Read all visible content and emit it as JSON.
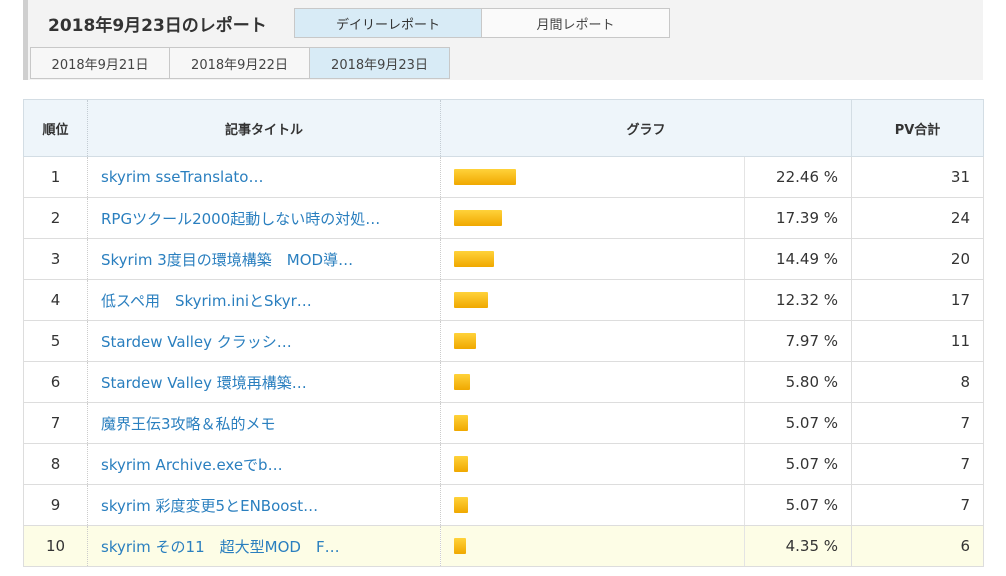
{
  "report": {
    "title": "2018年9月23日のレポート",
    "mode_tabs": [
      {
        "label": "デイリーレポート",
        "active": true
      },
      {
        "label": "月間レポート",
        "active": false
      }
    ],
    "date_tabs": [
      {
        "label": "2018年9月21日",
        "active": false
      },
      {
        "label": "2018年9月22日",
        "active": false
      },
      {
        "label": "2018年9月23日",
        "active": true
      }
    ]
  },
  "table": {
    "headers": {
      "rank": "順位",
      "title": "記事タイトル",
      "graph": "グラフ",
      "pv": "PV合計"
    },
    "rows": [
      {
        "rank": "1",
        "title": "skyrim sseTranslato…",
        "percent": 22.46,
        "percent_text": "22.46 %",
        "pv": "31"
      },
      {
        "rank": "2",
        "title": "RPGツクール2000起動しない時の対処…",
        "percent": 17.39,
        "percent_text": "17.39 %",
        "pv": "24"
      },
      {
        "rank": "3",
        "title": "Skyrim 3度目の環境構築　MOD導…",
        "percent": 14.49,
        "percent_text": "14.49 %",
        "pv": "20"
      },
      {
        "rank": "4",
        "title": "低スペ用　Skyrim.iniとSkyr…",
        "percent": 12.32,
        "percent_text": "12.32 %",
        "pv": "17"
      },
      {
        "rank": "5",
        "title": "Stardew Valley クラッシ…",
        "percent": 7.97,
        "percent_text": "7.97 %",
        "pv": "11"
      },
      {
        "rank": "6",
        "title": "Stardew Valley 環境再構築…",
        "percent": 5.8,
        "percent_text": "5.80 %",
        "pv": "8"
      },
      {
        "rank": "7",
        "title": "魔界王伝3攻略＆私的メモ",
        "percent": 5.07,
        "percent_text": "5.07 %",
        "pv": "7"
      },
      {
        "rank": "8",
        "title": "skyrim Archive.exeでb…",
        "percent": 5.07,
        "percent_text": "5.07 %",
        "pv": "7"
      },
      {
        "rank": "9",
        "title": "skyrim 彩度変更5とENBoost…",
        "percent": 5.07,
        "percent_text": "5.07 %",
        "pv": "7"
      },
      {
        "rank": "10",
        "title": "skyrim その11　超大型MOD　F…",
        "percent": 4.35,
        "percent_text": "4.35 %",
        "pv": "6",
        "highlight": true
      }
    ]
  },
  "colors": {
    "link": "#2a7fbf",
    "bar": "#f5b400",
    "active_tab": "#d8ebf6",
    "highlight_row": "#fdfde6"
  }
}
